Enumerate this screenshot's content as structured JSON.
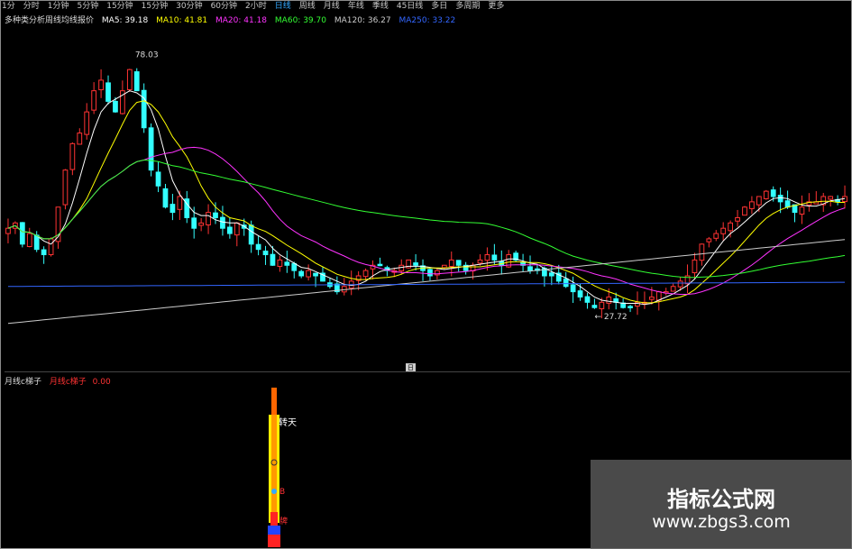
{
  "toolbar": {
    "items": [
      "1分",
      "分时",
      "1分钟",
      "5分钟",
      "15分钟",
      "15分钟",
      "30分钟",
      "60分钟",
      "2小时",
      "日线",
      "周线",
      "月线",
      "年线",
      "季线",
      "45日线",
      "多日",
      "多周期",
      "更多"
    ],
    "active_index": 9,
    "right_label": "",
    "right2_label": ""
  },
  "ma_legend": {
    "title": "多种类分析周线均线报价",
    "items": [
      {
        "label": "MA5: 39.18",
        "color": "#ffffff"
      },
      {
        "label": "MA10: 41.81",
        "color": "#ffff00"
      },
      {
        "label": "MA20: 41.18",
        "color": "#ff33ff"
      },
      {
        "label": "MA60: 39.70",
        "color": "#33ff33"
      },
      {
        "label": "MA120: 36.27",
        "color": "#cccccc"
      },
      {
        "label": "MA250: 33.22",
        "color": "#3366ff"
      }
    ]
  },
  "main_chart": {
    "high_label": "78.03",
    "low_label": "27.72",
    "badge": "日"
  },
  "sub_legend": {
    "name": "月线c梯子",
    "value_label": "月线c梯子",
    "value": "0.00"
  },
  "sub_labels": {
    "top": "转天",
    "mid": "B",
    "low": "牌"
  },
  "watermark": {
    "title": "指标公式网",
    "url": "www.zbgs3.com"
  },
  "chart_data": {
    "type": "candlestick",
    "x_count": 118,
    "y_range": [
      20,
      80
    ],
    "series_colors": {
      "up": "#ff3333",
      "down": "#33ffff"
    },
    "ma_colors": [
      "#ffffff",
      "#ffff00",
      "#ff33ff",
      "#33ff33",
      "#cccccc",
      "#3366ff"
    ],
    "closes": [
      44,
      45,
      41,
      43,
      40,
      39,
      42,
      48,
      55,
      60,
      62,
      66,
      70,
      72,
      68,
      66,
      70,
      74,
      70,
      63,
      55,
      52,
      48,
      47,
      50,
      46,
      44,
      45,
      47,
      46,
      44,
      43,
      45,
      44,
      41,
      40,
      39,
      37,
      38,
      37,
      36,
      35,
      36,
      35,
      34,
      33,
      32,
      33,
      34,
      35,
      36,
      37,
      37,
      36,
      36,
      37,
      38,
      37,
      36,
      35,
      36,
      37,
      38,
      37,
      36,
      37,
      38,
      39,
      38,
      37,
      39,
      38,
      37,
      36,
      36,
      35,
      35,
      34,
      33,
      32,
      31,
      30,
      29,
      30,
      31,
      30,
      29,
      29,
      30,
      30,
      31,
      32,
      32,
      33,
      34,
      35,
      38,
      41,
      42,
      43,
      44,
      45,
      46,
      48,
      49,
      50,
      51,
      50,
      49,
      48,
      47,
      48,
      49,
      49,
      50,
      50,
      49,
      50
    ],
    "candle_count_note": ""
  }
}
